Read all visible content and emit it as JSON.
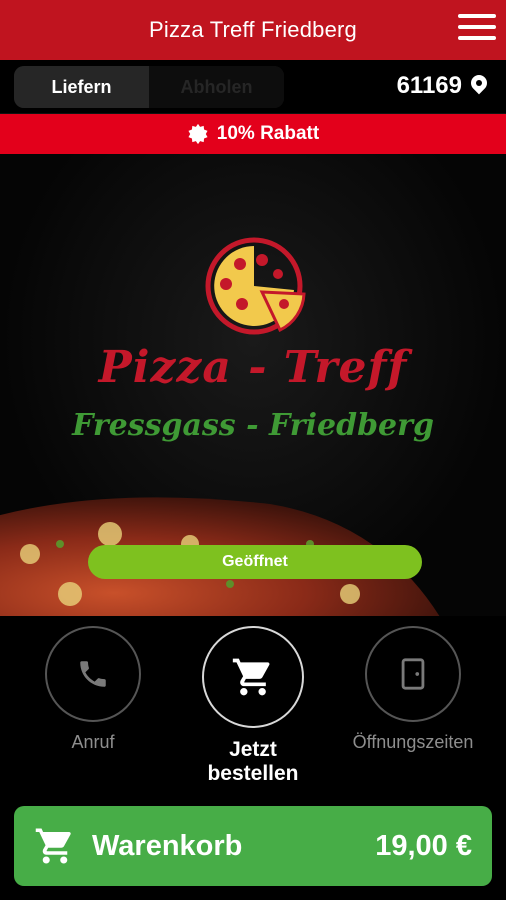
{
  "header": {
    "title": "Pizza Treff Friedberg"
  },
  "toggle": {
    "delivery_label": "Liefern",
    "pickup_label": "Abholen"
  },
  "location": {
    "zip": "61169"
  },
  "promo": {
    "text": "10% Rabatt"
  },
  "hero": {
    "brand_line1": "Pizza - Treff",
    "brand_line2": "Fressgass - Friedberg"
  },
  "status": {
    "label": "Geöffnet"
  },
  "actions": {
    "call_label": "Anruf",
    "order_label": "Jetzt bestellen",
    "hours_label": "Öffnungszeiten"
  },
  "cart": {
    "label": "Warenkorb",
    "total": "19,00 €"
  },
  "colors": {
    "brand_red": "#c0141f",
    "promo_red": "#e3001b",
    "open_green": "#7ec11f",
    "cart_green": "#47ad47"
  }
}
